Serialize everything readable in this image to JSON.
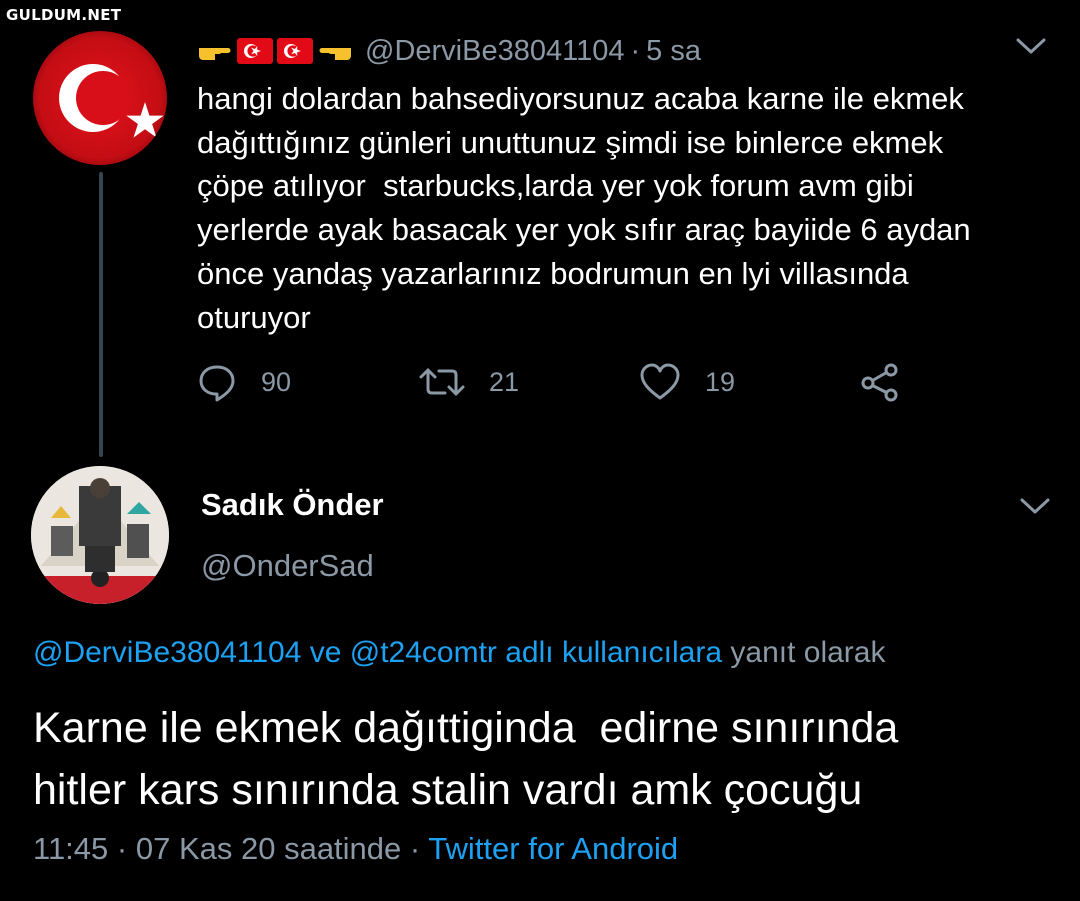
{
  "watermark": "GULDUM.NET",
  "parent_tweet": {
    "handle": "@DerviBe38041104",
    "separator": "·",
    "time": "5 sa",
    "text": "hangi dolardan bahsediyorsunuz acaba karne ile ekmek\ndağıttığınız günleri unuttunuz şimdi ise binlerce ekmek\nçöpe atılıyor  starbucks,larda yer yok forum avm gibi\nyerlerde ayak basacak yer yok sıfır araç bayiide 6 aydan\nönce yandaş yazarlarınız bodrumun en lyi villasında\noturuyor",
    "name_emojis": [
      "pointing-right-hand",
      "turkey-flag",
      "turkey-flag",
      "pointing-left-hand"
    ],
    "reply_count": "90",
    "retweet_count": "21",
    "like_count": "19",
    "icons": {
      "reply": "comment-icon",
      "retweet": "retweet-icon",
      "like": "heart-icon",
      "share": "share-icon",
      "menu": "chevron-down-icon"
    }
  },
  "main_tweet": {
    "name": "Sadık Önder",
    "handle": "@OnderSad",
    "reply_to_link": "@DerviBe38041104 ve @t24comtr adlı kullanıcılara",
    "reply_to_suffix": "yanıt olarak",
    "text": "Karne ile ekmek dağıttiginda  edirne sınırında\nhitler kars sınırında stalin vardı amk çocuğu",
    "time": "11:45",
    "separator": "·",
    "date": "07 Kas 20 saatinde",
    "separator2": "·",
    "source": "Twitter for Android"
  },
  "colors": {
    "background": "#000000",
    "text": "#ffffff",
    "secondary": "#8b98a5",
    "link": "#1da1f2",
    "flag_red": "#e30a17"
  }
}
